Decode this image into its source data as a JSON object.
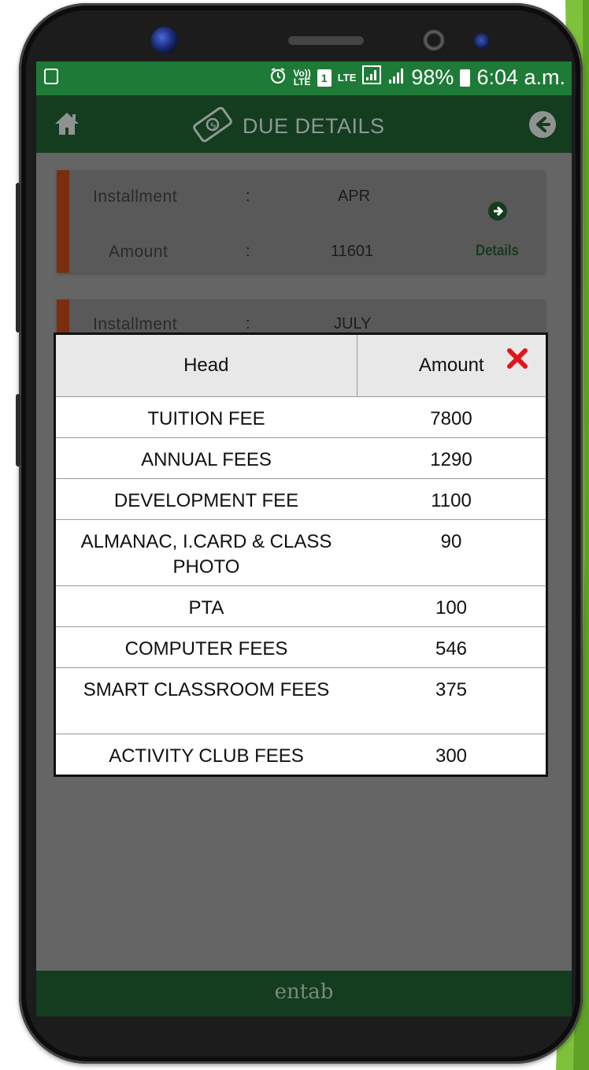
{
  "status_bar": {
    "volte_top": "Vo))",
    "volte_bottom": "LTE",
    "sim": "1",
    "lte": "LTE",
    "battery": "98%",
    "time": "6:04 a.m."
  },
  "header": {
    "title": "DUE DETAILS"
  },
  "cards": [
    {
      "installment_label": "Installment",
      "installment_value": "APR",
      "amount_label": "Amount",
      "amount_value": "11601",
      "details_label": "Details"
    },
    {
      "installment_label": "Installment",
      "installment_value": "JULY"
    }
  ],
  "modal": {
    "col_head": "Head",
    "col_amount": "Amount",
    "rows": [
      {
        "head": "TUITION FEE",
        "amount": "7800"
      },
      {
        "head": "ANNUAL FEES",
        "amount": "1290"
      },
      {
        "head": "DEVELOPMENT FEE",
        "amount": "1100"
      },
      {
        "head": "ALMANAC, I.CARD & CLASS PHOTO",
        "amount": "90"
      },
      {
        "head": "PTA",
        "amount": "100"
      },
      {
        "head": "COMPUTER FEES",
        "amount": "546"
      },
      {
        "head": "SMART CLASSROOM FEES",
        "amount": "375"
      },
      {
        "head": "ACTIVITY CLUB FEES",
        "amount": "300"
      }
    ]
  },
  "footer": {
    "logo": "entab"
  },
  "colors": {
    "status_green": "#1e7a37",
    "header_green": "#143c1f",
    "stripe": "#7a2e0e",
    "close": "#e0141a"
  }
}
